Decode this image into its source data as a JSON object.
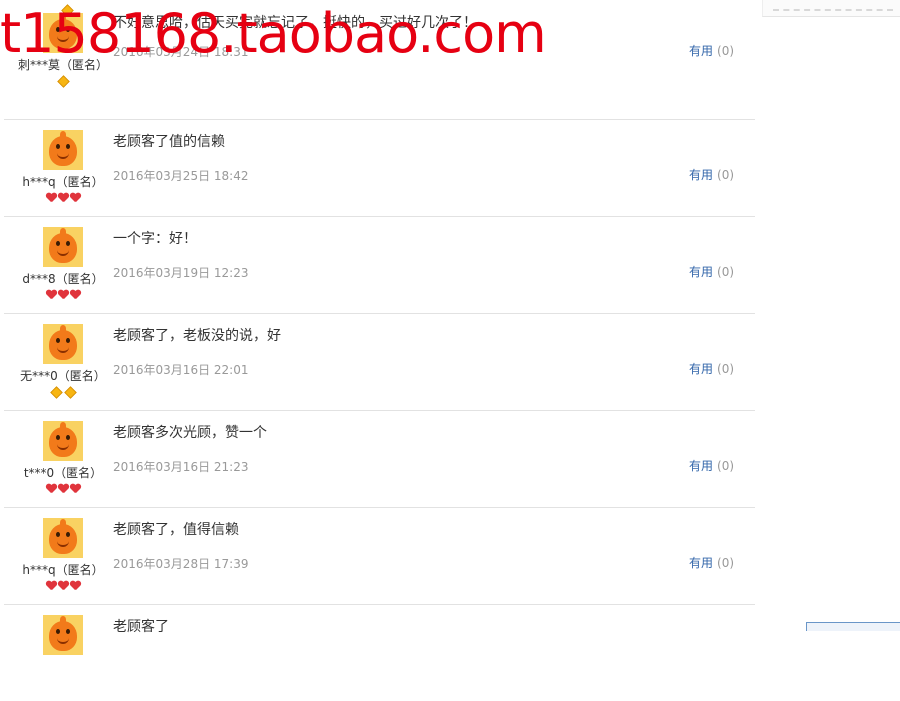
{
  "watermark": "t158168.taobao.com",
  "reviews": [
    {
      "user": "刺***莫（匿名）",
      "content": "不好意思哈，估天买完就忘记了，挺快的，买过好几次了！",
      "date": "2016年03月24日 18:31",
      "useful_label": "有用",
      "useful_count": "(0)",
      "badge_type": "diamond",
      "badge_count": 1
    },
    {
      "user": "h***q（匿名）",
      "content": "老顾客了值的信赖",
      "date": "2016年03月25日 18:42",
      "useful_label": "有用",
      "useful_count": "(0)",
      "badge_type": "heart",
      "badge_count": 3
    },
    {
      "user": "d***8（匿名）",
      "content": "一个字：好！",
      "date": "2016年03月19日 12:23",
      "useful_label": "有用",
      "useful_count": "(0)",
      "badge_type": "heart",
      "badge_count": 3
    },
    {
      "user": "无***0（匿名）",
      "content": "老顾客了，老板没的说，好",
      "date": "2016年03月16日 22:01",
      "useful_label": "有用",
      "useful_count": "(0)",
      "badge_type": "diamond",
      "badge_count": 2
    },
    {
      "user": "t***0（匿名）",
      "content": "老顾客多次光顾，赞一个",
      "date": "2016年03月16日 21:23",
      "useful_label": "有用",
      "useful_count": "(0)",
      "badge_type": "heart",
      "badge_count": 3
    },
    {
      "user": "h***q（匿名）",
      "content": "老顾客了，值得信赖",
      "date": "2016年03月28日 17:39",
      "useful_label": "有用",
      "useful_count": "(0)",
      "badge_type": "heart",
      "badge_count": 3
    },
    {
      "user": "",
      "content": "老顾客了",
      "date": "",
      "useful_label": "",
      "useful_count": "",
      "badge_type": "none",
      "badge_count": 0
    }
  ],
  "colors": {
    "watermark": "#e60012",
    "link": "#3366aa",
    "muted": "#999999",
    "heart": "#e0343c",
    "diamond": "#f7b512"
  },
  "icons": {
    "avatar": "taobao-doll-avatar-icon",
    "heart": "heart-badge-icon",
    "diamond": "diamond-badge-icon"
  }
}
